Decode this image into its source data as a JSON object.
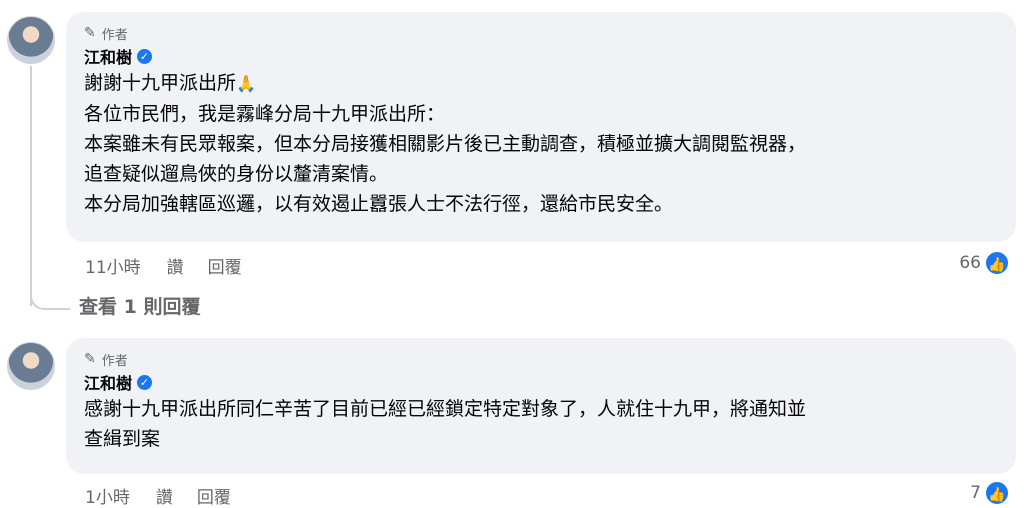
{
  "comments": [
    {
      "author_tag": "作者",
      "name": "江和樹",
      "lines": [
        "謝謝十九甲派出所",
        "各位市民們，我是霧峰分局十九甲派出所：",
        "本案雖未有民眾報案，但本分局接獲相關影片後已主動調查，積極並擴大調閱監視器，",
        "追查疑似遛鳥俠的身份以釐清案情。",
        "本分局加強轄區巡邏，以有效遏止囂張人士不法行徑，還給市民安全。"
      ],
      "time": "11小時",
      "like_label": "讚",
      "reply_label": "回覆",
      "like_count": "66"
    },
    {
      "author_tag": "作者",
      "name": "江和樹",
      "lines": [
        "感謝十九甲派出所同仁辛苦了目前已經已經鎖定特定對象了，人就住十九甲，將通知並",
        "查緝到案"
      ],
      "time": "1小時",
      "like_label": "讚",
      "reply_label": "回覆",
      "like_count": "7"
    }
  ],
  "view_replies": "查看 1 則回覆",
  "icons": {
    "pen": "pen-icon",
    "verified": "verified-badge-icon",
    "like": "like-thumb-icon",
    "pray": "praying-hands-emoji"
  },
  "colors": {
    "bubble": "#f0f2f5",
    "accent": "#1877f2",
    "secondary_text": "#65676b"
  }
}
